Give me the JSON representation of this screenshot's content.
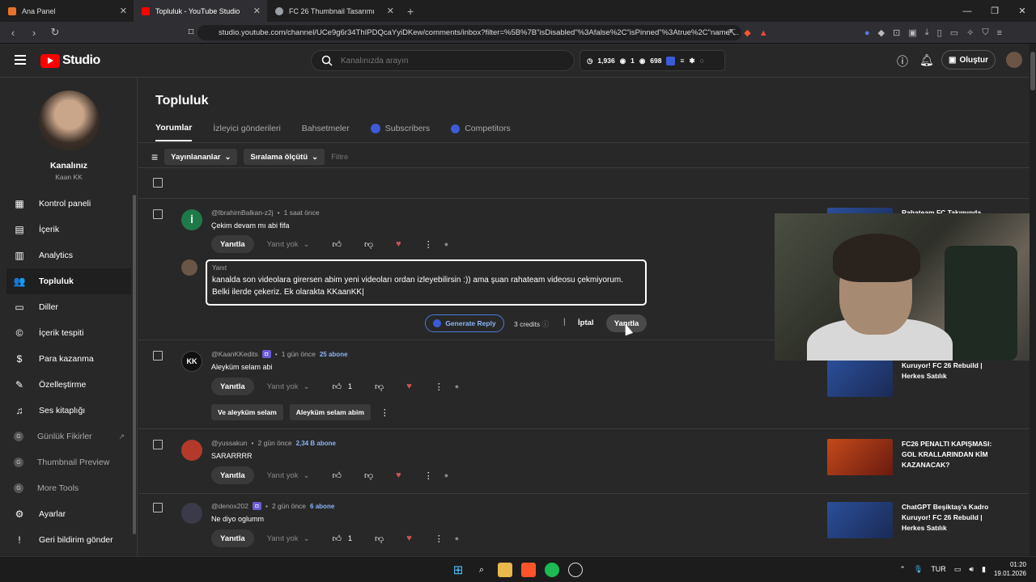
{
  "browser": {
    "tabs": [
      {
        "title": "Ana Panel",
        "color": "#e8712b"
      },
      {
        "title": "Topluluk - YouTube Studio",
        "color": "#ff0000"
      },
      {
        "title": "FC 26 Thumbnail Tasarımı",
        "color": "#9aa0a6"
      }
    ],
    "url": "studio.youtube.com/channel/UCe9g6r34ThIPDQcaYyiDKew/comments/inbox?filter=%5B%7B\"isDisabled\"%3Afalse%2C\"isPinned\"%3Atrue%2C\"name\"..."
  },
  "header": {
    "logo": "Studio",
    "search_placeholder": "Kanalınızda arayın",
    "stat1": "1,936",
    "stat2": "1",
    "stat3": "698",
    "create": "Oluştur"
  },
  "sidebar": {
    "channel_title": "Kanalınız",
    "channel_name": "Kaan KK",
    "items": [
      {
        "label": "Kontrol paneli",
        "icon": "▦"
      },
      {
        "label": "İçerik",
        "icon": "▤"
      },
      {
        "label": "Analytics",
        "icon": "▥"
      },
      {
        "label": "Topluluk",
        "icon": "👥"
      },
      {
        "label": "Diller",
        "icon": "▭"
      },
      {
        "label": "İçerik tespiti",
        "icon": "©"
      },
      {
        "label": "Para kazanma",
        "icon": "$"
      },
      {
        "label": "Özelleştirme",
        "icon": "✎"
      },
      {
        "label": "Ses kitaplığı",
        "icon": "♫"
      },
      {
        "label": "Günlük Fikirler",
        "icon": "●"
      },
      {
        "label": "Thumbnail Preview",
        "icon": "●"
      },
      {
        "label": "More Tools",
        "icon": "●"
      },
      {
        "label": "Ayarlar",
        "icon": "⚙"
      },
      {
        "label": "Geri bildirim gönder",
        "icon": "!"
      }
    ]
  },
  "main": {
    "title": "Topluluk",
    "tabs": [
      "Yorumlar",
      "İzleyici gönderileri",
      "Bahsetmeler",
      "Subscribers",
      "Competitors"
    ],
    "filter_published": "Yayınlananlar",
    "filter_sort": "Sıralama ölçütü",
    "filter_placeholder": "Filtre",
    "reply_label": "Yanıtla",
    "no_reply": "Yanıt yok"
  },
  "comments": [
    {
      "author": "@IbrahimBalkan-z2j",
      "time": "1 saat önce",
      "text": "Çekim devam mı abi fifa",
      "avatar_letter": "İ",
      "avatar_color": "#1f7a4a",
      "likes": ""
    },
    {
      "author": "@KaanKKedits",
      "time": "1 gün önce",
      "subs": "25 abone",
      "text": "Aleyküm selam abi",
      "avatar_letter": "KK",
      "avatar_color": "#111111",
      "likes": "1"
    },
    {
      "author": "@yussakun",
      "time": "2 gün önce",
      "subs": "2,34 B abone",
      "text": "SARARRRR",
      "avatar_letter": "",
      "avatar_color": "#b33a2a",
      "likes": ""
    },
    {
      "author": "@denox202",
      "time": "2 gün önce",
      "subs": "6 abone",
      "text": "Ne diyo oglumm",
      "avatar_letter": "",
      "avatar_color": "#3a3a4a",
      "likes": "1"
    }
  ],
  "reply_box": {
    "label": "Yanıt",
    "text": "kanalda son videolara girersen abim yeni videoları ordan izleyebilirsin :)) ama şuan rahateam videosu çekmiyorum. Belki ilerde çekeriz. Ek olarakta KKaanKK|",
    "generate": "Generate Reply",
    "credits": "3 credits",
    "cancel": "İptal",
    "submit": "Yanıtla"
  },
  "suggestions": [
    "Ve aleyküm selam",
    "Aleyküm selam abim"
  ],
  "videos": [
    {
      "title": "Rahateam FC Takımında",
      "color": "#2b4f9a"
    },
    {
      "title": "Kuruyor! FC 26 Rebuild | Herkes Satılık",
      "color": "#2b4f9a"
    },
    {
      "title": "FC26 PENALTI KAPIŞMASI: GOL KRALLARINDAN KİM KAZANACAK?",
      "color": "#c44a1a"
    },
    {
      "title": "ChatGPT Beşiktaş'a Kadro Kuruyor! FC 26 Rebuild | Herkes Satılık",
      "color": "#2b4f9a"
    }
  ],
  "taskbar": {
    "lang": "TUR",
    "time": "01:20",
    "date": "19.01.2026"
  }
}
